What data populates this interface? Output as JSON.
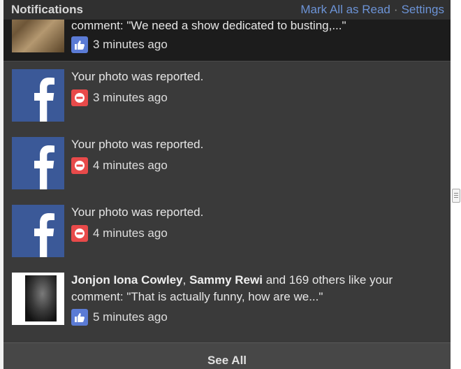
{
  "header": {
    "title": "Notifications",
    "mark_all_read": "Mark All as Read",
    "separator": "·",
    "settings": "Settings"
  },
  "notifications": [
    {
      "text_partial": "comment: \"We need a show dedicated to busting,...\"",
      "icon": "like-icon",
      "time": "3 minutes ago",
      "thumbnail": "photo"
    },
    {
      "text": "Your photo was reported.",
      "icon": "report-icon",
      "time": "3 minutes ago",
      "thumbnail": "facebook-logo"
    },
    {
      "text": "Your photo was reported.",
      "icon": "report-icon",
      "time": "4 minutes ago",
      "thumbnail": "facebook-logo"
    },
    {
      "text": "Your photo was reported.",
      "icon": "report-icon",
      "time": "4 minutes ago",
      "thumbnail": "facebook-logo"
    },
    {
      "actor1": "Jonjon Iona Cowley",
      "comma": ", ",
      "actor2": "Sammy Rewi",
      "text_rest": " and 169 others like your comment: \"That is actually funny, how are we...\"",
      "icon": "like-icon",
      "time": "5 minutes ago",
      "thumbnail": "avatar"
    }
  ],
  "footer": {
    "see_all": "See All"
  },
  "colors": {
    "panel_bg": "#3a3a3a",
    "header_bg": "#303030",
    "link": "#6c93d6",
    "facebook_blue": "#3b5998",
    "like_icon_bg": "#5b7bd5",
    "report_icon_bg": "#e84a4a"
  }
}
